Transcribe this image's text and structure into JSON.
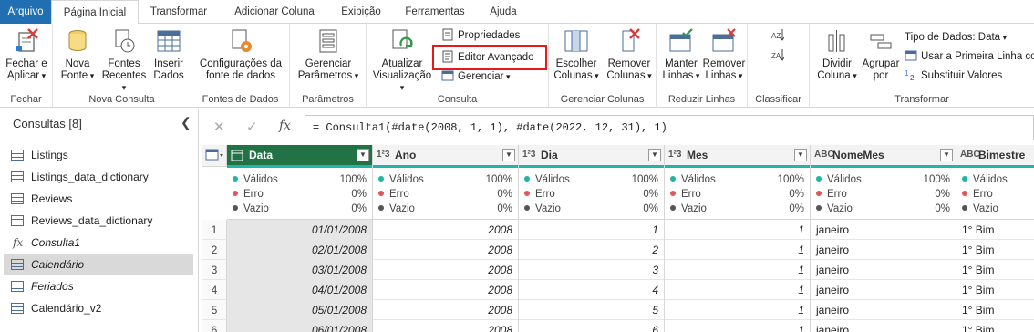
{
  "tabs": [
    "Arquivo",
    "Página Inicial",
    "Transformar",
    "Adicionar Coluna",
    "Exibição",
    "Ferramentas",
    "Ajuda"
  ],
  "ribbon": {
    "fechar": {
      "label": "Fechar",
      "close_apply": "Fechar e",
      "close_apply2": "Aplicar"
    },
    "nova_consulta": {
      "label": "Nova Consulta",
      "nova_fonte": "Nova",
      "nova_fonte2": "Fonte",
      "fontes_recentes": "Fontes",
      "fontes_recentes2": "Recentes",
      "inserir_dados": "Inserir",
      "inserir_dados2": "Dados"
    },
    "fontes_dados": {
      "label": "Fontes de Dados",
      "config": "Configurações da",
      "config2": "fonte de dados"
    },
    "parametros": {
      "label": "Parâmetros",
      "gerenciar": "Gerenciar",
      "gerenciar2": "Parâmetros"
    },
    "consulta": {
      "label": "Consulta",
      "atualizar": "Atualizar",
      "atualizar2": "Visualização",
      "propriedades": "Propriedades",
      "editor_avancado": "Editor Avançado",
      "gerenciar": "Gerenciar"
    },
    "gerenciar_colunas": {
      "label": "Gerenciar Colunas",
      "escolher": "Escolher",
      "escolher2": "Colunas",
      "remover": "Remover",
      "remover2": "Colunas"
    },
    "reduzir_linhas": {
      "label": "Reduzir Linhas",
      "manter": "Manter",
      "manter2": "Linhas",
      "remover": "Remover",
      "remover2": "Linhas"
    },
    "classificar": {
      "label": "Classificar"
    },
    "transformar": {
      "label": "Transformar",
      "dividir": "Dividir",
      "dividir2": "Coluna",
      "agrupar": "Agrupar",
      "agrupar2": "por",
      "tipo_dados": "Tipo de Dados: Data",
      "primeira_linha": "Usar a Primeira Linha co",
      "substituir": "Substituir Valores"
    }
  },
  "queries": {
    "title": "Consultas [8]",
    "items": [
      {
        "label": "Listings",
        "kind": "table"
      },
      {
        "label": "Listings_data_dictionary",
        "kind": "table"
      },
      {
        "label": "Reviews",
        "kind": "table"
      },
      {
        "label": "Reviews_data_dictionary",
        "kind": "table"
      },
      {
        "label": "Consulta1",
        "kind": "function"
      },
      {
        "label": "Calendário",
        "kind": "table",
        "selected": true
      },
      {
        "label": "Feriados",
        "kind": "table"
      },
      {
        "label": "Calendário_v2",
        "kind": "table"
      }
    ]
  },
  "formula": "= Consulta1(#date(2008, 1, 1), #date(2022, 12, 31), 1)",
  "grid": {
    "stat_labels": [
      "Válidos",
      "Erro",
      "Vazio"
    ],
    "columns": [
      {
        "name": "Data",
        "type_icon": "date",
        "stats": [
          "100%",
          "0%",
          "0%"
        ],
        "align": "right",
        "values": [
          "01/01/2008",
          "02/01/2008",
          "03/01/2008",
          "04/01/2008",
          "05/01/2008",
          "06/01/2008"
        ]
      },
      {
        "name": "Ano",
        "type_icon": "1²3",
        "stats": [
          "100%",
          "0%",
          "0%"
        ],
        "align": "right",
        "values": [
          "2008",
          "2008",
          "2008",
          "2008",
          "2008",
          "2008"
        ]
      },
      {
        "name": "Dia",
        "type_icon": "1²3",
        "stats": [
          "100%",
          "0%",
          "0%"
        ],
        "align": "right",
        "values": [
          "1",
          "2",
          "3",
          "4",
          "5",
          "6"
        ]
      },
      {
        "name": "Mes",
        "type_icon": "1²3",
        "stats": [
          "100%",
          "0%",
          "0%"
        ],
        "align": "right",
        "values": [
          "1",
          "1",
          "1",
          "1",
          "1",
          "1"
        ]
      },
      {
        "name": "NomeMes",
        "type_icon": "ABC",
        "stats": [
          "100%",
          "0%",
          "0%"
        ],
        "align": "left",
        "values": [
          "janeiro",
          "janeiro",
          "janeiro",
          "janeiro",
          "janeiro",
          "janeiro"
        ]
      },
      {
        "name": "Bimestre",
        "type_icon": "ABC",
        "stats": [
          "",
          "",
          ""
        ],
        "align": "left",
        "values": [
          "1° Bim",
          "1° Bim",
          "1° Bim",
          "1° Bim",
          "1° Bim",
          "1° Bim"
        ]
      }
    ],
    "row_numbers": [
      "1",
      "2",
      "3",
      "4",
      "5",
      "6"
    ]
  },
  "colors": {
    "file_tab": "#1f6fb2",
    "selected_column": "#217346",
    "quality_bar": "#1fb6a5",
    "valid_dot": "#1fb6a5",
    "error_dot": "#e4555a",
    "empty_dot": "#555555",
    "highlight": "#e21b1b"
  }
}
